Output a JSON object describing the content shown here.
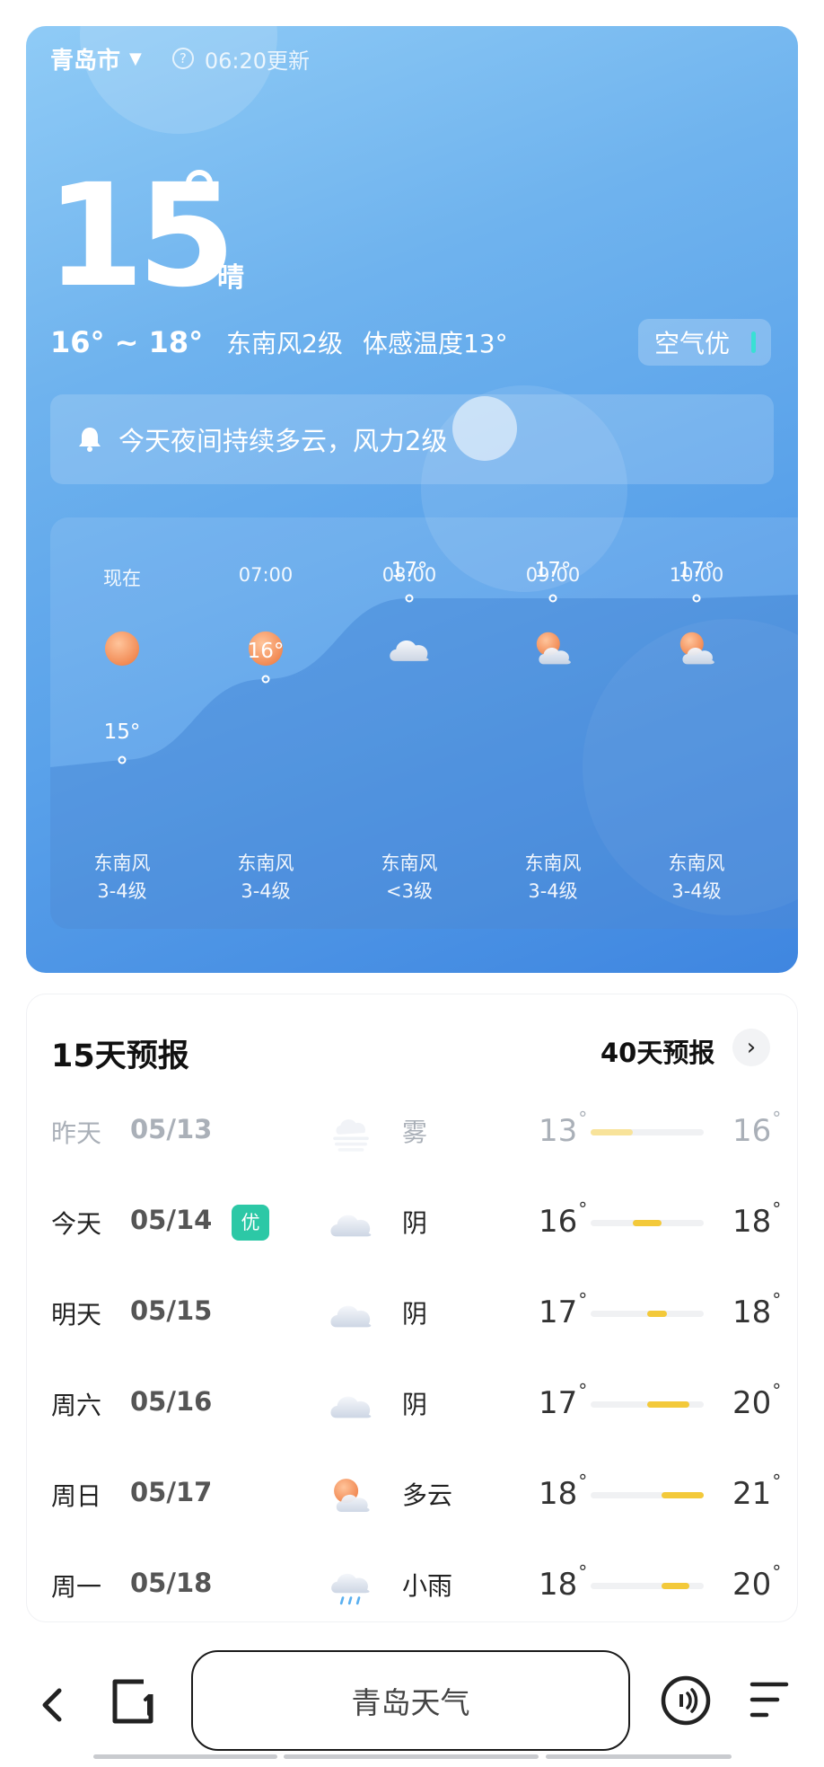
{
  "header": {
    "city": "青岛市",
    "updated": "06:20更新"
  },
  "current": {
    "temp": "15",
    "condition": "晴",
    "range": "16° ~ 18°",
    "wind": "东南风2级",
    "feels_like": "体感温度13°",
    "aqi": "空气优"
  },
  "alert": {
    "text": "今天夜间持续多云，风力2级"
  },
  "hourly": [
    {
      "time": "现在",
      "icon": "sun-icon",
      "temp": 15,
      "temp_label": "15°",
      "wind_dir": "东南风",
      "wind_level": "3-4级"
    },
    {
      "time": "07:00",
      "icon": "sun-icon",
      "temp": 16,
      "temp_label": "16°",
      "wind_dir": "东南风",
      "wind_level": "3-4级"
    },
    {
      "time": "08:00",
      "icon": "overcast-icon",
      "temp": 17,
      "temp_label": "17°",
      "wind_dir": "东南风",
      "wind_level": "<3级"
    },
    {
      "time": "09:00",
      "icon": "partly-cloudy-icon",
      "temp": 17,
      "temp_label": "17°",
      "wind_dir": "东南风",
      "wind_level": "3-4级"
    },
    {
      "time": "10:00",
      "icon": "partly-cloudy-icon",
      "temp": 17,
      "temp_label": "17°",
      "wind_dir": "东南风",
      "wind_level": "3-4级"
    }
  ],
  "forecast": {
    "title": "15天预报",
    "more_label": "40天预报",
    "range_min": 13,
    "range_max": 21,
    "days": [
      {
        "day": "昨天",
        "date": "05/13",
        "badge": "",
        "icon": "fog-icon",
        "condition": "雾",
        "low": 13,
        "low_label": "13",
        "high": 16,
        "high_label": "16",
        "past": true
      },
      {
        "day": "今天",
        "date": "05/14",
        "badge": "优",
        "icon": "overcast-icon",
        "condition": "阴",
        "low": 16,
        "low_label": "16",
        "high": 18,
        "high_label": "18",
        "past": false
      },
      {
        "day": "明天",
        "date": "05/15",
        "badge": "",
        "icon": "overcast-icon",
        "condition": "阴",
        "low": 17,
        "low_label": "17",
        "high": 18,
        "high_label": "18",
        "past": false
      },
      {
        "day": "周六",
        "date": "05/16",
        "badge": "",
        "icon": "overcast-icon",
        "condition": "阴",
        "low": 17,
        "low_label": "17",
        "high": 20,
        "high_label": "20",
        "past": false
      },
      {
        "day": "周日",
        "date": "05/17",
        "badge": "",
        "icon": "partly-cloudy-icon",
        "condition": "多云",
        "low": 18,
        "low_label": "18",
        "high": 21,
        "high_label": "21",
        "past": false
      },
      {
        "day": "周一",
        "date": "05/18",
        "badge": "",
        "icon": "light-rain-icon",
        "condition": "小雨",
        "low": 18,
        "low_label": "18",
        "high": 20,
        "high_label": "20",
        "past": false
      }
    ]
  },
  "bottom_bar": {
    "search_text": "青岛天气"
  },
  "colors": {
    "card_blue": "#5aa2ea",
    "sun_orange": "#f49a62",
    "aqi_accent": "#39e0d4",
    "badge_green": "#2cc8a6",
    "range_yellow": "#f3c93a"
  }
}
